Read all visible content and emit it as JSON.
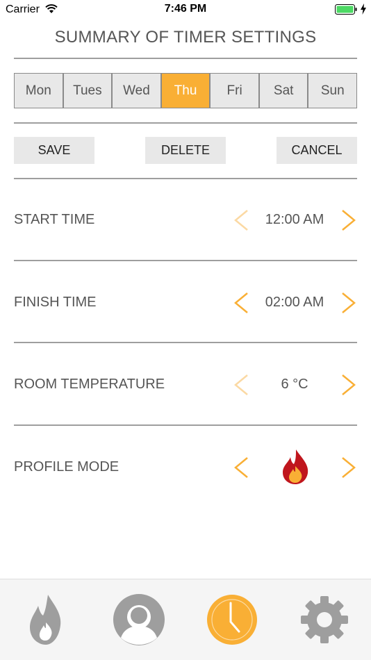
{
  "status_bar": {
    "carrier": "Carrier",
    "time": "7:46 PM"
  },
  "title": "SUMMARY OF TIMER SETTINGS",
  "days": [
    {
      "label": "Mon",
      "selected": false
    },
    {
      "label": "Tues",
      "selected": false
    },
    {
      "label": "Wed",
      "selected": false
    },
    {
      "label": "Thu",
      "selected": true
    },
    {
      "label": "Fri",
      "selected": false
    },
    {
      "label": "Sat",
      "selected": false
    },
    {
      "label": "Sun",
      "selected": false
    }
  ],
  "actions": {
    "save": "SAVE",
    "delete": "DELETE",
    "cancel": "CANCEL"
  },
  "settings": {
    "start_time": {
      "label": "START TIME",
      "value": "12:00 AM",
      "prev_enabled": false,
      "next_enabled": true
    },
    "finish_time": {
      "label": "FINISH TIME",
      "value": "02:00 AM",
      "prev_enabled": true,
      "next_enabled": true
    },
    "room_temperature": {
      "label": "ROOM TEMPERATURE",
      "value": "6 °C",
      "prev_enabled": false,
      "next_enabled": true
    },
    "profile_mode": {
      "label": "PROFILE MODE",
      "icon": "flame-icon",
      "prev_enabled": true,
      "next_enabled": true
    }
  },
  "tabs": [
    {
      "icon": "flame-icon",
      "active": false
    },
    {
      "icon": "profile-icon",
      "active": false
    },
    {
      "icon": "clock-icon",
      "active": true
    },
    {
      "icon": "gear-icon",
      "active": false
    }
  ],
  "colors": {
    "accent": "#f9af35",
    "accent_disabled": "#fbd9a3",
    "inactive_icon": "#9e9e9e",
    "flame_outer": "#c0161d",
    "flame_inner": "#f9af35"
  }
}
